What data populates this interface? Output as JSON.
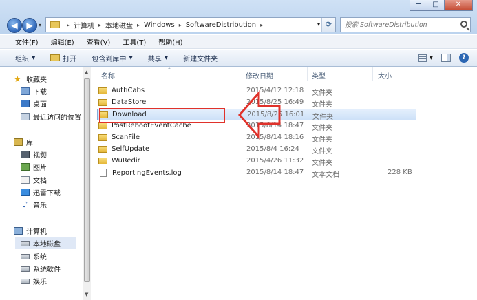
{
  "window": {
    "minimize_label": "─",
    "maximize_label": "□",
    "close_label": "✕"
  },
  "nav": {
    "back_label": "◀",
    "forward_label": "▶",
    "dropdown": "▾"
  },
  "address": {
    "crumbs": [
      "计算机",
      "本地磁盘",
      "Windows",
      "SoftwareDistribution"
    ],
    "separator": "▸",
    "dropdown": "▾",
    "refresh": "⟳"
  },
  "search": {
    "placeholder": "搜索 SoftwareDistribution"
  },
  "menubar": {
    "items": [
      "文件(F)",
      "编辑(E)",
      "查看(V)",
      "工具(T)",
      "帮助(H)"
    ]
  },
  "toolbar": {
    "organize": "组织",
    "open": "打开",
    "include_in_library": "包含到库中",
    "share": "共享",
    "new_folder": "新建文件夹",
    "caret": "▼",
    "help": "?"
  },
  "navpane": {
    "favorites": {
      "label": "收藏夹",
      "items": [
        "下载",
        "桌面",
        "最近访问的位置"
      ]
    },
    "libraries": {
      "label": "库",
      "items": [
        "视频",
        "图片",
        "文档",
        "迅雷下载",
        "音乐"
      ]
    },
    "computer": {
      "label": "计算机",
      "items": [
        "本地磁盘",
        "系统",
        "系统软件",
        "娱乐"
      ]
    },
    "star": "★",
    "music_note": "♪",
    "scroll_up": "▲",
    "scroll_down": "▼"
  },
  "columns": {
    "name": "名称",
    "date": "修改日期",
    "type": "类型",
    "size": "大小",
    "sort_indicator": "^"
  },
  "files": [
    {
      "name": "AuthCabs",
      "date": "2015/4/12 12:18",
      "type": "文件夹",
      "size": "",
      "kind": "folder"
    },
    {
      "name": "DataStore",
      "date": "2015/8/25 16:49",
      "type": "文件夹",
      "size": "",
      "kind": "folder"
    },
    {
      "name": "Download",
      "date": "2015/8/25 16:01",
      "type": "文件夹",
      "size": "",
      "kind": "folder"
    },
    {
      "name": "PostRebootEventCache",
      "date": "2015/8/14 18:47",
      "type": "文件夹",
      "size": "",
      "kind": "folder"
    },
    {
      "name": "ScanFile",
      "date": "2015/8/14 18:16",
      "type": "文件夹",
      "size": "",
      "kind": "folder"
    },
    {
      "name": "SelfUpdate",
      "date": "2015/8/4 16:24",
      "type": "文件夹",
      "size": "",
      "kind": "folder"
    },
    {
      "name": "WuRedir",
      "date": "2015/4/26 11:32",
      "type": "文件夹",
      "size": "",
      "kind": "folder"
    },
    {
      "name": "ReportingEvents.log",
      "date": "2015/8/14 18:47",
      "type": "文本文档",
      "size": "228 KB",
      "kind": "log"
    }
  ],
  "selected_file": "Download",
  "colors": {
    "annotation_red": "#e0322b",
    "selection_border": "#84acdd"
  }
}
